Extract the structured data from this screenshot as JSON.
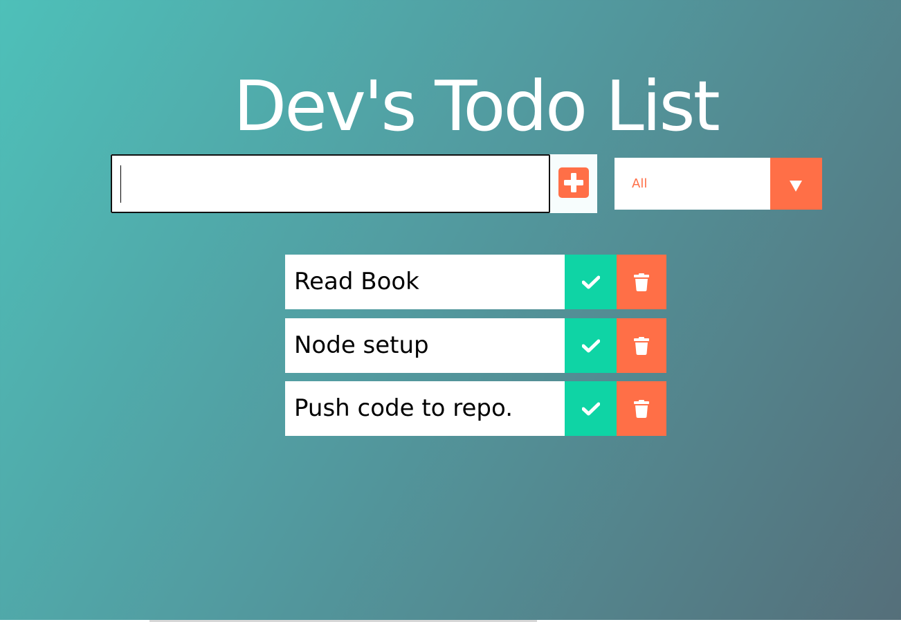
{
  "header": {
    "title": "Dev's Todo List"
  },
  "form": {
    "input_value": "",
    "add_icon": "plus-square-icon",
    "filter": {
      "selected": "All",
      "arrow_icon": "caret-down-icon"
    }
  },
  "todos": [
    {
      "text": "Read Book",
      "complete_icon": "check-icon",
      "delete_icon": "trash-icon"
    },
    {
      "text": "Node setup",
      "complete_icon": "check-icon",
      "delete_icon": "trash-icon"
    },
    {
      "text": "Push code to repo.",
      "complete_icon": "check-icon",
      "delete_icon": "trash-icon"
    }
  ],
  "colors": {
    "accent": "#ff6f47",
    "complete": "#0fd4a5",
    "gradient_start": "#4ec0b9",
    "gradient_end": "#556f7a"
  }
}
